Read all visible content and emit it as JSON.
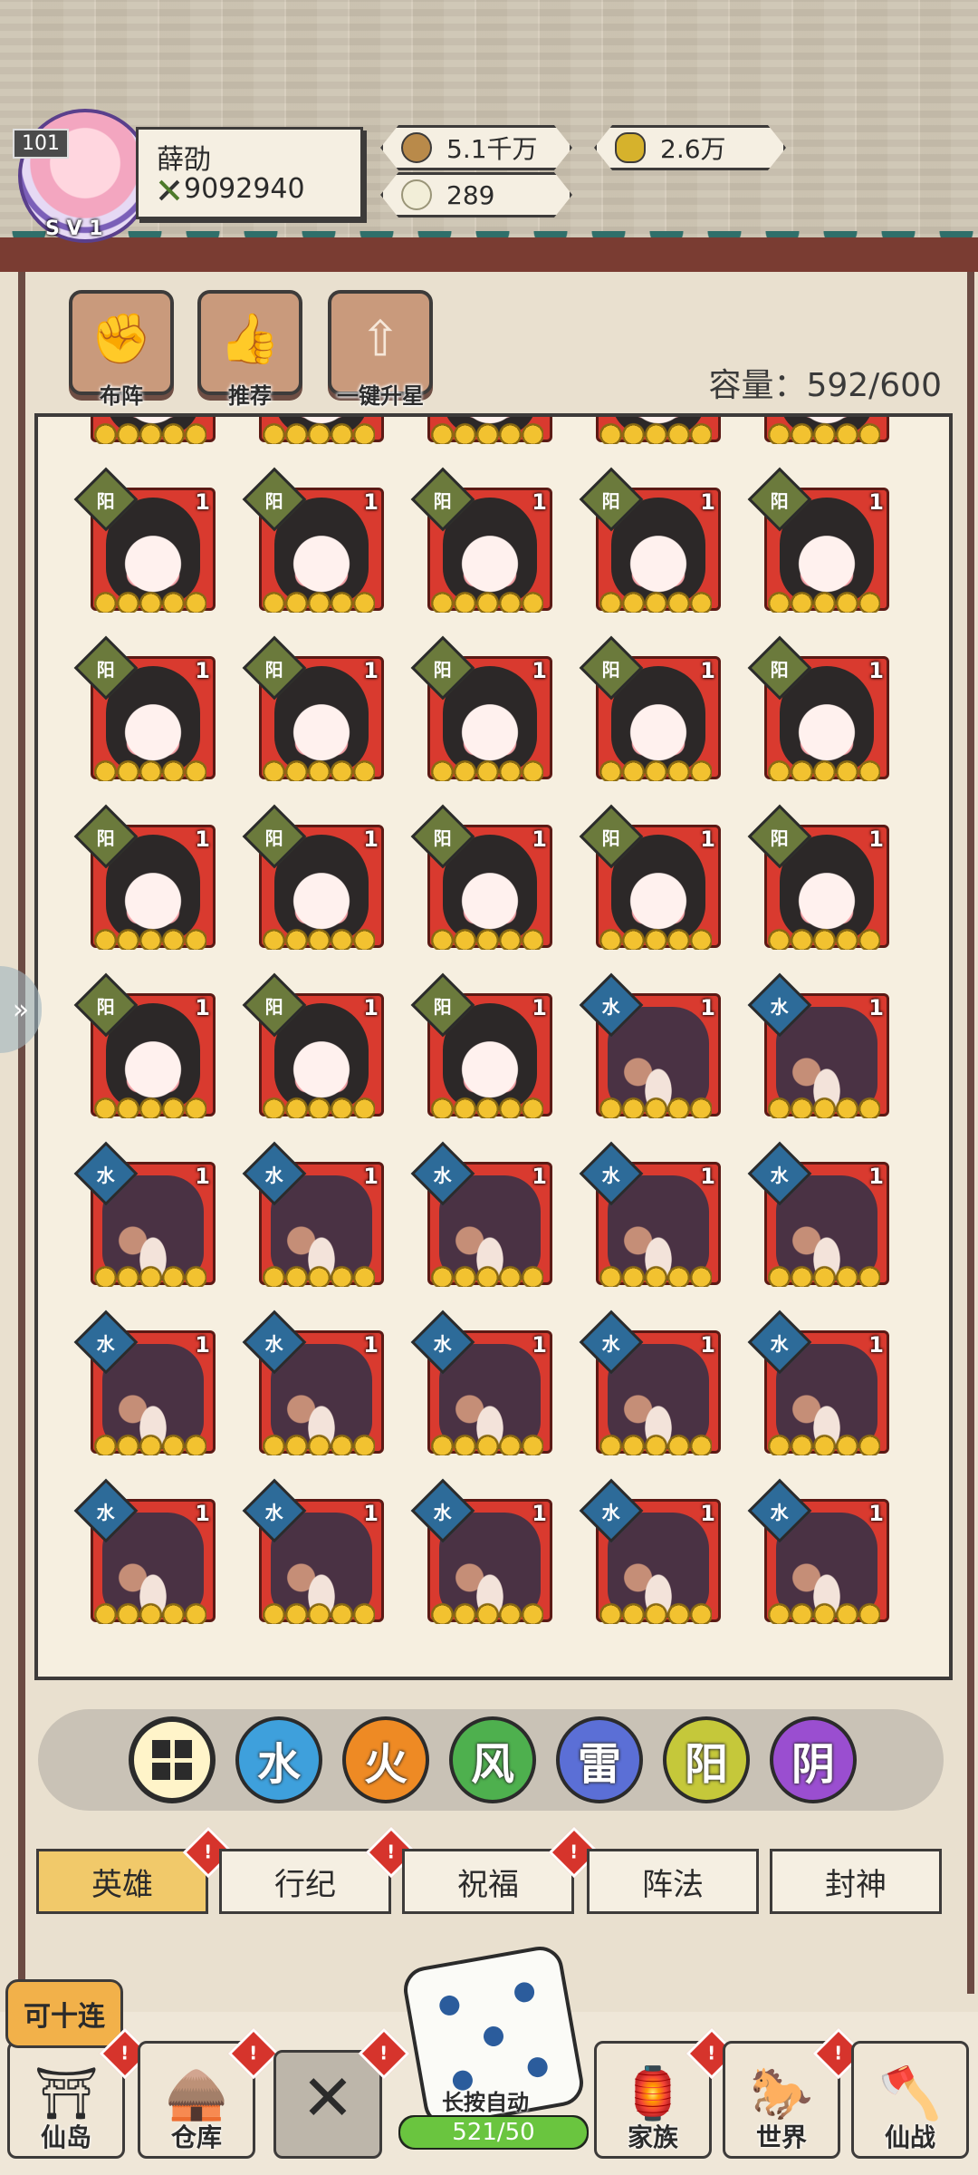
{
  "player": {
    "level": "101",
    "vip": "S V 1",
    "name": "薛劭",
    "power": "9092940"
  },
  "resources": {
    "coin": "5.1千万",
    "gold": "2.6万",
    "pearl": "289"
  },
  "actions": {
    "formation": "布阵",
    "recommend": "推荐",
    "star_up": "一键升星"
  },
  "capacity": "容量：592/600",
  "hero_grid": {
    "rows": [
      {
        "element": "阳",
        "count": 5,
        "type": "yang"
      },
      {
        "element": "阳",
        "count": 5,
        "type": "yang"
      },
      {
        "element": "阳",
        "count": 5,
        "type": "yang"
      },
      {
        "element": "阳",
        "count": 5,
        "type": "yang"
      },
      {
        "element": "mixed",
        "types": [
          "yang",
          "yang",
          "yang",
          "shui",
          "shui"
        ]
      },
      {
        "element": "水",
        "count": 5,
        "type": "shui"
      },
      {
        "element": "水",
        "count": 5,
        "type": "shui"
      },
      {
        "element": "水",
        "count": 5,
        "type": "shui"
      }
    ],
    "star_number": "1",
    "element_labels": {
      "yang": "阳",
      "shui": "水"
    }
  },
  "filters": [
    {
      "id": "all",
      "label": "",
      "color": "#fff4c9"
    },
    {
      "id": "water",
      "label": "水",
      "color": "#3ea0dc"
    },
    {
      "id": "fire",
      "label": "火",
      "color": "#ee8a24"
    },
    {
      "id": "wind",
      "label": "风",
      "color": "#4eb04e"
    },
    {
      "id": "thunder",
      "label": "雷",
      "color": "#5b6fd6"
    },
    {
      "id": "yang",
      "label": "阳",
      "color": "#c5c83a"
    },
    {
      "id": "yin",
      "label": "阴",
      "color": "#9a4ed0"
    }
  ],
  "tabs": [
    {
      "label": "英雄",
      "active": true,
      "alert": "!"
    },
    {
      "label": "行纪",
      "active": false,
      "alert": "!"
    },
    {
      "label": "祝福",
      "active": false,
      "alert": "!"
    },
    {
      "label": "阵法",
      "active": false,
      "alert": ""
    },
    {
      "label": "封神",
      "active": false,
      "alert": ""
    }
  ],
  "bottom_nav": {
    "ten_pull": "可十连",
    "island": "仙岛",
    "warehouse": "仓库",
    "dice_label": "长按自动",
    "energy_text": "521/50",
    "energy_fraction": 1.0,
    "clan": "家族",
    "world": "世界",
    "battle": "仙战"
  },
  "colors": {
    "card_red": "#d93a2f",
    "active_tab": "#f1c96a",
    "alert_red": "#d6342c"
  }
}
